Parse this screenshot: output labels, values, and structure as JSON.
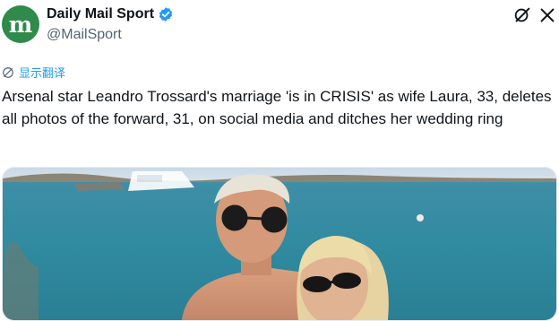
{
  "account": {
    "display_name": "Daily Mail Sport",
    "handle": "@MailSport",
    "avatar_letter": "m",
    "avatar_color": "#2f8a4b",
    "verified": true
  },
  "header_icons": [
    "grok-icon",
    "more-icon"
  ],
  "translate": {
    "label": "显示翻译",
    "icon": "globe-icon"
  },
  "tweet": {
    "text": "Arsenal star Leandro Trossard's marriage 'is in CRISIS' as wife Laura, 33, deletes all photos of the forward, 31, on social media and ditches her wedding ring"
  },
  "media": {
    "description_icon": "photo"
  },
  "colors": {
    "accent": "#1d9bf0",
    "text": "#0f1419",
    "secondary": "#536471"
  }
}
